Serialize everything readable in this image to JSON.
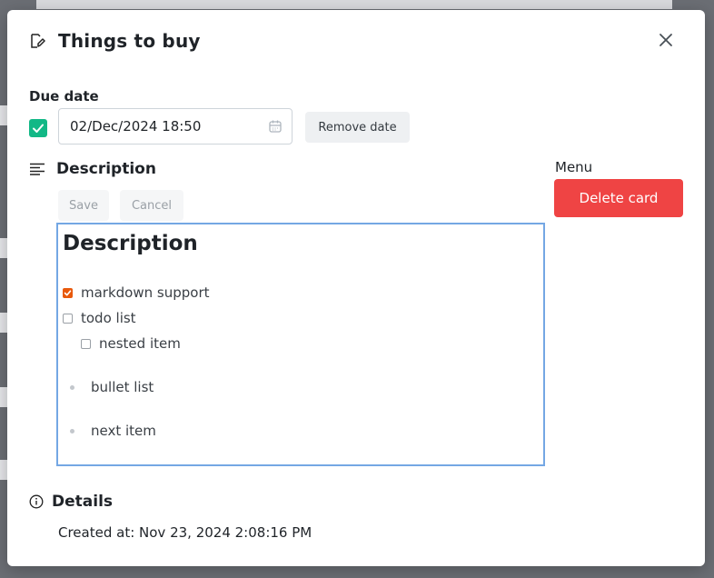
{
  "modal": {
    "title": "Things to buy",
    "due_label": "Due date",
    "due_checked": true,
    "due_value": "02/Dec/2024 18:50",
    "remove_date_label": "Remove date",
    "description_title": "Description",
    "save_label": "Save",
    "cancel_label": "Cancel",
    "menu_label": "Menu",
    "delete_label": "Delete card",
    "details_title": "Details",
    "created_at": "Created at: Nov 23, 2024 2:08:16 PM"
  },
  "editor": {
    "heading": "Description",
    "todos": [
      {
        "text": "markdown support",
        "checked": true
      },
      {
        "text": "todo list",
        "checked": false
      },
      {
        "text": "nested item",
        "checked": false
      }
    ],
    "bullets": [
      "bullet list",
      "next item"
    ]
  },
  "colors": {
    "accent_green": "#12b886",
    "danger": "#ef4444",
    "focus_border": "#74a7e4",
    "todo_checked": "#e8590c"
  },
  "icons": {
    "title": "edit-icon",
    "close": "close-icon",
    "calendar": "calendar-icon",
    "description": "align-left-icon",
    "details": "info-icon"
  }
}
